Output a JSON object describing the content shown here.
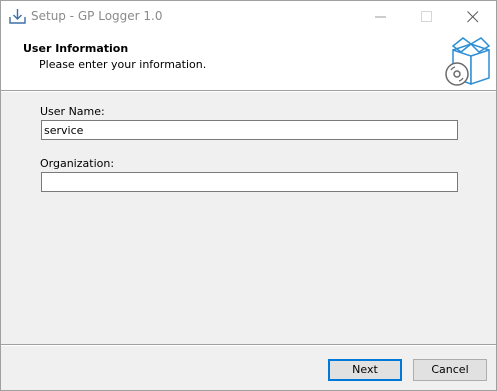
{
  "window": {
    "title": "Setup - GP Logger 1.0"
  },
  "header": {
    "title": "User Information",
    "subtitle": "Please enter your information."
  },
  "form": {
    "user_name_label": "User Name:",
    "user_name_value": "service",
    "organization_label": "Organization:",
    "organization_value": ""
  },
  "buttons": {
    "next_label": "Next",
    "cancel_label": "Cancel"
  },
  "icons": {
    "app": "installer-icon",
    "wizard": "box-disc-icon",
    "minimize": "minimize-icon",
    "maximize": "maximize-icon",
    "close": "close-icon"
  },
  "colors": {
    "accent": "#0078d7",
    "window_bg": "#f0f0f0"
  }
}
